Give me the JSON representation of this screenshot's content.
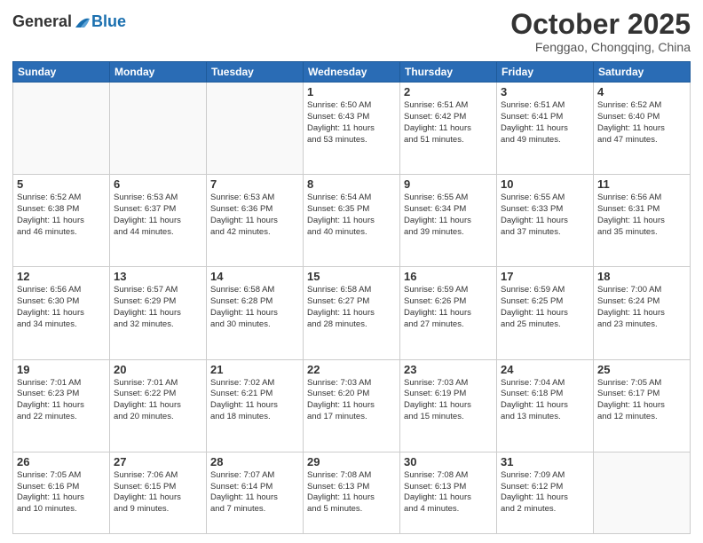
{
  "header": {
    "logo_general": "General",
    "logo_blue": "Blue",
    "month_title": "October 2025",
    "location": "Fenggao, Chongqing, China"
  },
  "weekdays": [
    "Sunday",
    "Monday",
    "Tuesday",
    "Wednesday",
    "Thursday",
    "Friday",
    "Saturday"
  ],
  "weeks": [
    [
      {
        "day": "",
        "info": ""
      },
      {
        "day": "",
        "info": ""
      },
      {
        "day": "",
        "info": ""
      },
      {
        "day": "1",
        "info": "Sunrise: 6:50 AM\nSunset: 6:43 PM\nDaylight: 11 hours\nand 53 minutes."
      },
      {
        "day": "2",
        "info": "Sunrise: 6:51 AM\nSunset: 6:42 PM\nDaylight: 11 hours\nand 51 minutes."
      },
      {
        "day": "3",
        "info": "Sunrise: 6:51 AM\nSunset: 6:41 PM\nDaylight: 11 hours\nand 49 minutes."
      },
      {
        "day": "4",
        "info": "Sunrise: 6:52 AM\nSunset: 6:40 PM\nDaylight: 11 hours\nand 47 minutes."
      }
    ],
    [
      {
        "day": "5",
        "info": "Sunrise: 6:52 AM\nSunset: 6:38 PM\nDaylight: 11 hours\nand 46 minutes."
      },
      {
        "day": "6",
        "info": "Sunrise: 6:53 AM\nSunset: 6:37 PM\nDaylight: 11 hours\nand 44 minutes."
      },
      {
        "day": "7",
        "info": "Sunrise: 6:53 AM\nSunset: 6:36 PM\nDaylight: 11 hours\nand 42 minutes."
      },
      {
        "day": "8",
        "info": "Sunrise: 6:54 AM\nSunset: 6:35 PM\nDaylight: 11 hours\nand 40 minutes."
      },
      {
        "day": "9",
        "info": "Sunrise: 6:55 AM\nSunset: 6:34 PM\nDaylight: 11 hours\nand 39 minutes."
      },
      {
        "day": "10",
        "info": "Sunrise: 6:55 AM\nSunset: 6:33 PM\nDaylight: 11 hours\nand 37 minutes."
      },
      {
        "day": "11",
        "info": "Sunrise: 6:56 AM\nSunset: 6:31 PM\nDaylight: 11 hours\nand 35 minutes."
      }
    ],
    [
      {
        "day": "12",
        "info": "Sunrise: 6:56 AM\nSunset: 6:30 PM\nDaylight: 11 hours\nand 34 minutes."
      },
      {
        "day": "13",
        "info": "Sunrise: 6:57 AM\nSunset: 6:29 PM\nDaylight: 11 hours\nand 32 minutes."
      },
      {
        "day": "14",
        "info": "Sunrise: 6:58 AM\nSunset: 6:28 PM\nDaylight: 11 hours\nand 30 minutes."
      },
      {
        "day": "15",
        "info": "Sunrise: 6:58 AM\nSunset: 6:27 PM\nDaylight: 11 hours\nand 28 minutes."
      },
      {
        "day": "16",
        "info": "Sunrise: 6:59 AM\nSunset: 6:26 PM\nDaylight: 11 hours\nand 27 minutes."
      },
      {
        "day": "17",
        "info": "Sunrise: 6:59 AM\nSunset: 6:25 PM\nDaylight: 11 hours\nand 25 minutes."
      },
      {
        "day": "18",
        "info": "Sunrise: 7:00 AM\nSunset: 6:24 PM\nDaylight: 11 hours\nand 23 minutes."
      }
    ],
    [
      {
        "day": "19",
        "info": "Sunrise: 7:01 AM\nSunset: 6:23 PM\nDaylight: 11 hours\nand 22 minutes."
      },
      {
        "day": "20",
        "info": "Sunrise: 7:01 AM\nSunset: 6:22 PM\nDaylight: 11 hours\nand 20 minutes."
      },
      {
        "day": "21",
        "info": "Sunrise: 7:02 AM\nSunset: 6:21 PM\nDaylight: 11 hours\nand 18 minutes."
      },
      {
        "day": "22",
        "info": "Sunrise: 7:03 AM\nSunset: 6:20 PM\nDaylight: 11 hours\nand 17 minutes."
      },
      {
        "day": "23",
        "info": "Sunrise: 7:03 AM\nSunset: 6:19 PM\nDaylight: 11 hours\nand 15 minutes."
      },
      {
        "day": "24",
        "info": "Sunrise: 7:04 AM\nSunset: 6:18 PM\nDaylight: 11 hours\nand 13 minutes."
      },
      {
        "day": "25",
        "info": "Sunrise: 7:05 AM\nSunset: 6:17 PM\nDaylight: 11 hours\nand 12 minutes."
      }
    ],
    [
      {
        "day": "26",
        "info": "Sunrise: 7:05 AM\nSunset: 6:16 PM\nDaylight: 11 hours\nand 10 minutes."
      },
      {
        "day": "27",
        "info": "Sunrise: 7:06 AM\nSunset: 6:15 PM\nDaylight: 11 hours\nand 9 minutes."
      },
      {
        "day": "28",
        "info": "Sunrise: 7:07 AM\nSunset: 6:14 PM\nDaylight: 11 hours\nand 7 minutes."
      },
      {
        "day": "29",
        "info": "Sunrise: 7:08 AM\nSunset: 6:13 PM\nDaylight: 11 hours\nand 5 minutes."
      },
      {
        "day": "30",
        "info": "Sunrise: 7:08 AM\nSunset: 6:13 PM\nDaylight: 11 hours\nand 4 minutes."
      },
      {
        "day": "31",
        "info": "Sunrise: 7:09 AM\nSunset: 6:12 PM\nDaylight: 11 hours\nand 2 minutes."
      },
      {
        "day": "",
        "info": ""
      }
    ]
  ]
}
